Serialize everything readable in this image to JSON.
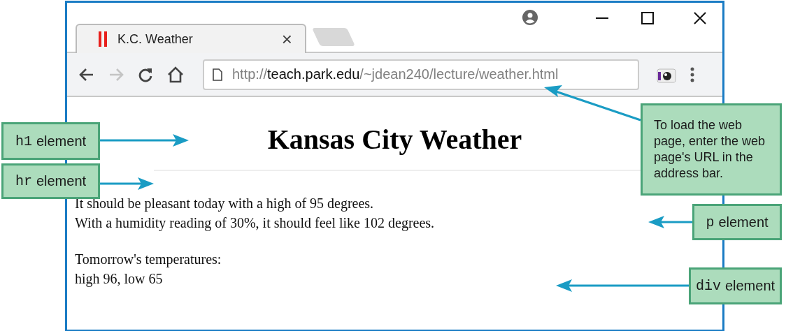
{
  "browser": {
    "tab": {
      "title": "K.C. Weather",
      "close": "×"
    },
    "address": {
      "scheme": "http://",
      "host": "teach.park.edu",
      "path": "/~jdean240/lecture/weather.html"
    },
    "page": {
      "heading": "Kansas City Weather",
      "paragraph": [
        "It should be pleasant today with a high of 95 degrees.",
        "With a humidity reading of 30%, it should feel like 102 degrees."
      ],
      "div": [
        "Tomorrow's temperatures:",
        "high 96, low 65"
      ]
    }
  },
  "callouts": [
    {
      "kind": "element",
      "code": "h1",
      "label": "element"
    },
    {
      "kind": "element",
      "code": "hr",
      "label": "element"
    },
    {
      "kind": "note",
      "text": "To load the web page, enter the web page's URL in the address bar."
    },
    {
      "kind": "element",
      "code": "p",
      "label": "element"
    },
    {
      "kind": "element",
      "code": "div",
      "label": "element"
    }
  ]
}
